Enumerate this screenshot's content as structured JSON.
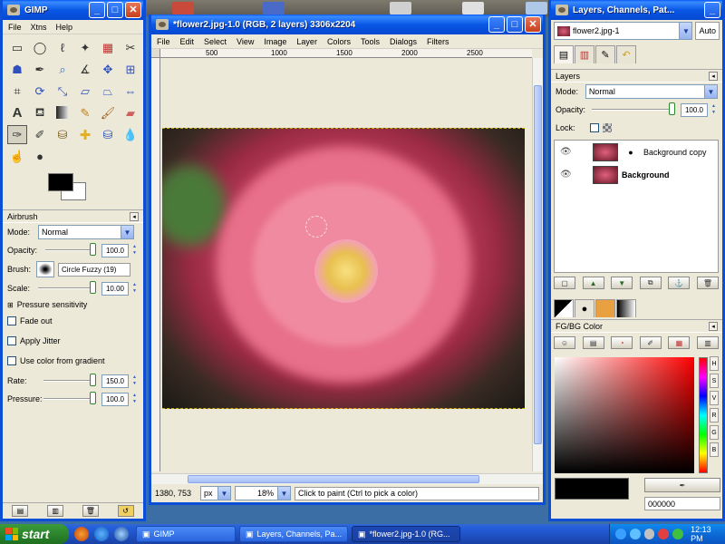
{
  "toolbox": {
    "title": "GIMP",
    "menu": [
      "File",
      "Xtns",
      "Help"
    ],
    "tools": [
      "rect-select",
      "ellipse-select",
      "lasso",
      "fuzzy-select",
      "by-color-select",
      "scissors",
      "foreground-select",
      "color-picker",
      "zoom",
      "measure",
      "move",
      "align",
      "crop",
      "rotate",
      "scale",
      "shear",
      "perspective",
      "flip",
      "text",
      "bucket-fill",
      "blend",
      "pencil",
      "paintbrush",
      "eraser",
      "airbrush",
      "ink",
      "clone",
      "heal",
      "perspective-clone",
      "blur",
      "smudge",
      "dodge-burn"
    ],
    "selected_tool": 25,
    "options": {
      "title": "Airbrush",
      "mode_label": "Mode:",
      "mode_value": "Normal",
      "opacity_label": "Opacity:",
      "opacity_value": "100.0",
      "brush_label": "Brush:",
      "brush_value": "Circle Fuzzy (19)",
      "scale_label": "Scale:",
      "scale_value": "10.00",
      "pressure_sens": "Pressure sensitivity",
      "fade_out": "Fade out",
      "apply_jitter": "Apply Jitter",
      "use_gradient": "Use color from gradient",
      "rate_label": "Rate:",
      "rate_value": "150.0",
      "pressure_label": "Pressure:",
      "pressure_value": "100.0"
    }
  },
  "image_window": {
    "title": "*flower2.jpg-1.0 (RGB, 2 layers) 3306x2204",
    "menu": [
      "File",
      "Edit",
      "Select",
      "View",
      "Image",
      "Layer",
      "Colors",
      "Tools",
      "Dialogs",
      "Filters"
    ],
    "ruler_labels": [
      "500",
      "1000",
      "1500",
      "2000",
      "2500"
    ],
    "status": {
      "coords": "1380, 753",
      "unit": "px",
      "zoom": "18%",
      "message": "Click to paint (Ctrl to pick a color)"
    }
  },
  "layers_dialog": {
    "title": "Layers, Channels, Pat...",
    "image_select": "flower2.jpg-1",
    "auto_label": "Auto",
    "section_title": "Layers",
    "mode_label": "Mode:",
    "mode_value": "Normal",
    "opacity_label": "Opacity:",
    "opacity_value": "100.0",
    "lock_label": "Lock:",
    "layers": [
      {
        "name": "Background copy",
        "bold": false
      },
      {
        "name": "Background",
        "bold": true
      }
    ],
    "fgbg_title": "FG/BG Color",
    "hsv_buttons": [
      "H",
      "S",
      "V",
      "R",
      "G",
      "B"
    ],
    "hex_value": "000000"
  },
  "taskbar": {
    "start": "start",
    "items": [
      {
        "label": "GIMP",
        "active": false
      },
      {
        "label": "Layers, Channels, Pa...",
        "active": false
      },
      {
        "label": "*flower2.jpg-1.0 (RG...",
        "active": true
      }
    ],
    "clock": "12:13 PM"
  },
  "colors": {
    "fg": "#000000",
    "bg": "#ffffff",
    "xp_blue": "#0b4fd6"
  }
}
